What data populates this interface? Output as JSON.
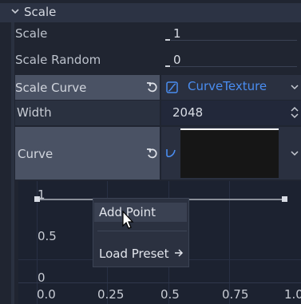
{
  "section": {
    "title": "Scale"
  },
  "properties": {
    "scale": {
      "label": "Scale",
      "value": "1"
    },
    "scale_random": {
      "label": "Scale Random",
      "value": "0"
    },
    "scale_curve": {
      "label": "Scale Curve",
      "resource": "CurveTexture"
    },
    "width": {
      "label": "Width",
      "value": "2048"
    },
    "curve": {
      "label": "Curve"
    }
  },
  "graph": {
    "y_labels": [
      "1",
      "0.5",
      "0"
    ],
    "x_labels": [
      "0.0",
      "0.25",
      "0.5",
      "0.75",
      "1.0"
    ]
  },
  "context_menu": {
    "items": [
      {
        "label": "Add Point"
      },
      {
        "label": "Load Preset"
      }
    ]
  },
  "colors": {
    "accent": "#4a8df0",
    "highlight_row": "#4a5264",
    "panel_bg": "#202531",
    "graph_bg": "#1c2230"
  }
}
